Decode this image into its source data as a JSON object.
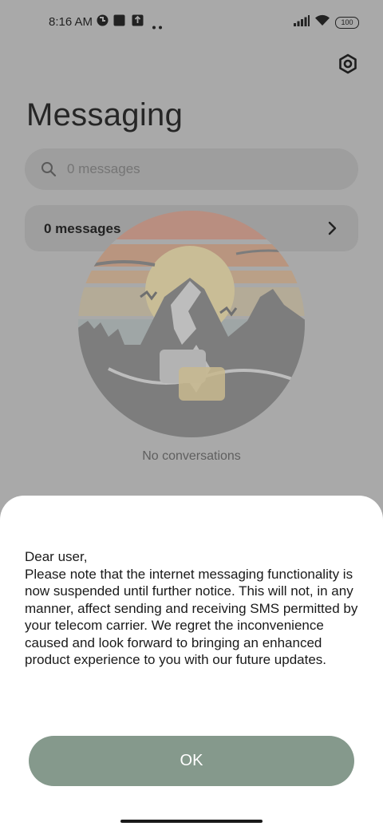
{
  "status_bar": {
    "time": "8:16 AM",
    "battery_level": "100",
    "icons": [
      "vpn-icon",
      "square-notification-icon",
      "upload-notification-icon",
      "more-notifications-icon",
      "signal-icon",
      "wifi-icon",
      "battery-icon"
    ]
  },
  "header": {
    "title": "Messaging",
    "settings_icon": "gear-icon"
  },
  "search": {
    "placeholder": "0 messages"
  },
  "messages_row": {
    "label": "0 messages"
  },
  "empty_state": {
    "text": "No conversations"
  },
  "dialog": {
    "greeting": "Dear user,",
    "body": "Please note that the internet messaging functionality is now suspended until further notice. This will not, in any manner, affect sending and receiving SMS permitted by your telecom carrier. We regret the inconvenience caused and look forward to bringing an enhanced product experience to you with our future updates.",
    "ok_label": "OK"
  },
  "colors": {
    "scrim": "#a9a9a9",
    "ok_button": "#85998c",
    "dialog_bg": "#ffffff"
  }
}
